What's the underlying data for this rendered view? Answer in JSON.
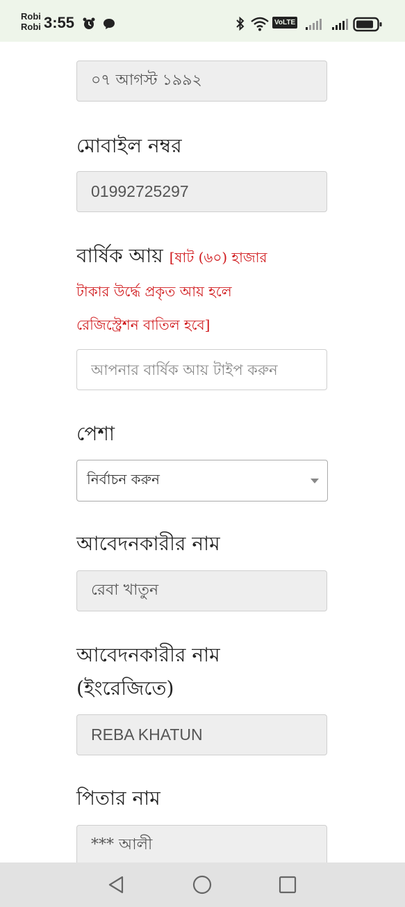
{
  "status_bar": {
    "carrier_1": "Robi",
    "carrier_2": "Robi",
    "time": "3:55",
    "volte": "VoLTE",
    "icons": [
      "alarm-icon",
      "chat-icon",
      "bluetooth-icon",
      "wifi-icon",
      "volte-icon",
      "signal-icon",
      "signal-icon",
      "battery-icon"
    ]
  },
  "form": {
    "dob_value": "০৭ আগস্ট ১৯৯২",
    "mobile_label": "মোবাইল নম্বর",
    "mobile_value": "01992725297",
    "income_label": "বার্ষিক আয়",
    "income_note_1": "[ষাট (৬০) হাজার",
    "income_note_2": "টাকার উর্দ্ধে প্রকৃত আয় হলে",
    "income_note_3": "রেজিস্ট্রেশন বাতিল হবে]",
    "income_placeholder": "আপনার বার্ষিক আয় টাইপ করুন",
    "profession_label": "পেশা",
    "profession_selected": "নির্বাচন করুন",
    "applicant_name_label": "আবেদনকারীর নাম",
    "applicant_name_value": "রেবা খাতুন",
    "applicant_name_en_label_1": "আবেদনকারীর নাম",
    "applicant_name_en_label_2": "(ইংরেজিতে)",
    "applicant_name_en_value": "REBA KHATUN",
    "father_name_label": "পিতার নাম",
    "father_name_value": "*** আলী"
  },
  "colors": {
    "status_bg": "#eef5ea",
    "note_red": "#d0191c",
    "readonly_bg": "#eeeeee",
    "nav_bg": "#e2e2e2"
  }
}
